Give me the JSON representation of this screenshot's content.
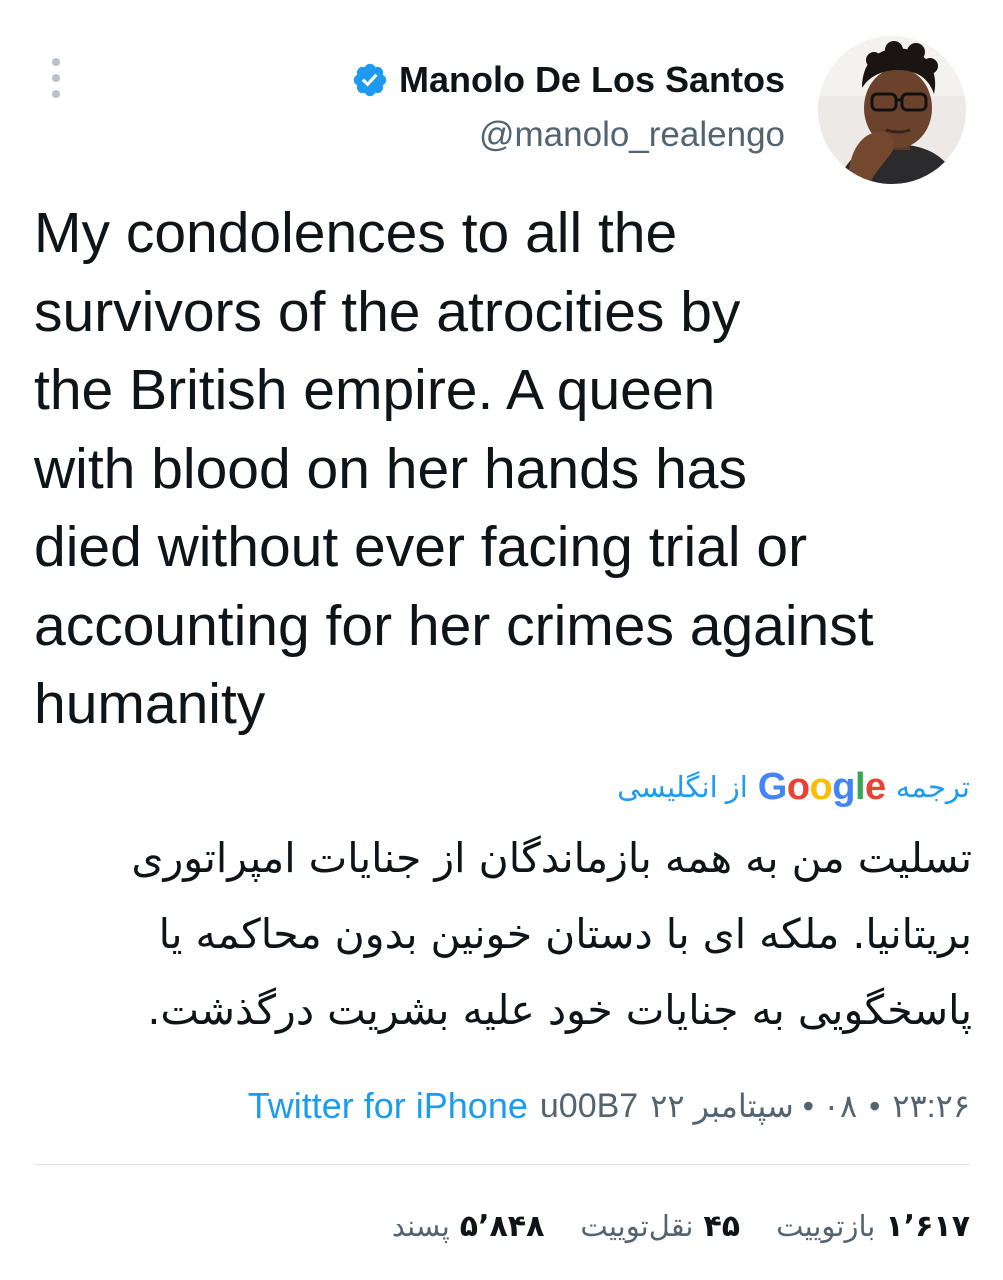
{
  "header": {
    "display_name": "Manolo De Los Santos",
    "handle": "@manolo_realengo",
    "verified": true,
    "verified_color": "#1d9bf0"
  },
  "icons": {
    "more": "more-vertical-icon",
    "verified": "verified-badge-icon",
    "avatar": "avatar"
  },
  "tweet": {
    "text": "My condolences to all the\nsurvivors of the atrocities by\nthe British empire. A queen\nwith blood on her hands has\ndied without ever facing trial or\naccounting for her crimes against\nhumanity"
  },
  "translation": {
    "label_translate": "ترجمه",
    "label_google": "Google",
    "label_from": "از انگلیسی",
    "text": "تسلیت من به همه بازماندگان از جنایات امپراتوری\nبریتانیا. ملکه ای با دستان خونین بدون محاکمه یا\nپاسخگویی به جنایات خود علیه بشریت درگذشت."
  },
  "meta": {
    "time": "۲۳:۲۶",
    "dot1": "•",
    "date": "۰۸ • سپتامبر ۲۲",
    "code": "u00B7",
    "source": "Twitter for iPhone"
  },
  "stats": {
    "retweets_num": "۱٬۶۱۷",
    "retweets_label": "بازتوییت",
    "quotes_num": "۴۵",
    "quotes_label": "نقل‌توییت",
    "likes_num": "۵٬۸۴۸",
    "likes_label": "پسند"
  },
  "colors": {
    "accent": "#1d9bf0",
    "text": "#0f1419",
    "muted": "#536471",
    "divider": "#dfe3e6"
  }
}
